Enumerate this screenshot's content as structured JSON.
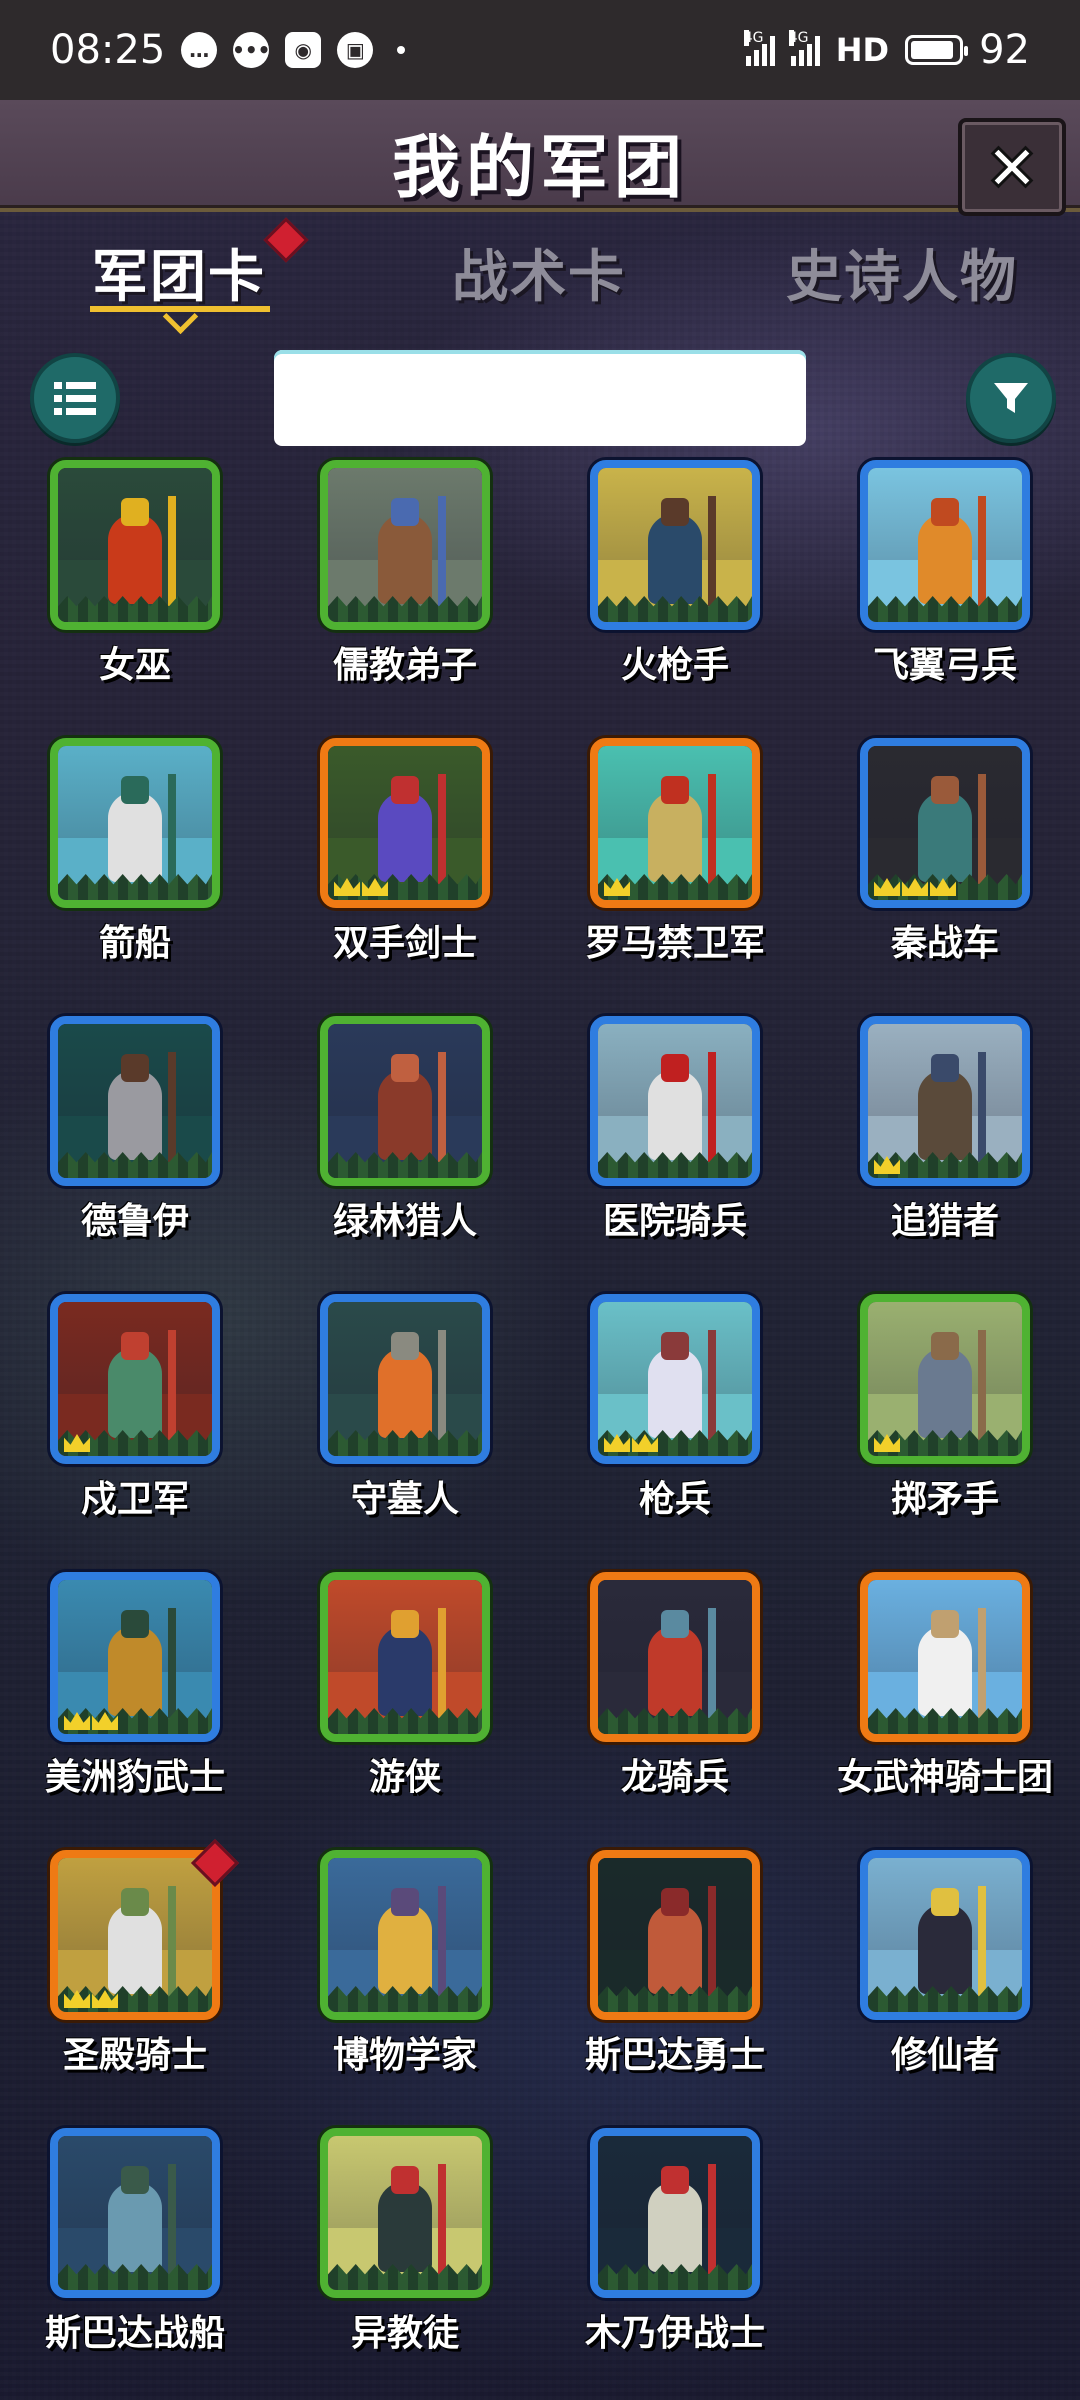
{
  "status_bar": {
    "time": "08:25",
    "notif_icons": [
      "chat-bubble-icon",
      "message-icon",
      "weibo-icon",
      "app-icon"
    ],
    "signal1_label": "4G",
    "signal2_label": "4G",
    "hd_label": "HD",
    "battery_percent": 92,
    "battery_text": "92"
  },
  "header": {
    "title": "我的军团",
    "close_icon": "close-icon"
  },
  "tabs": [
    {
      "label": "军团卡",
      "active": true,
      "has_badge": true
    },
    {
      "label": "战术卡",
      "active": false,
      "has_badge": false
    },
    {
      "label": "史诗人物",
      "active": false,
      "has_badge": false
    }
  ],
  "toolbar": {
    "list_icon": "list-icon",
    "filter_icon": "filter-icon",
    "search_value": "",
    "search_placeholder": ""
  },
  "colors": {
    "green": "#4fb232",
    "blue": "#2f7de0",
    "orange": "#ef7a14",
    "badge": "#d02030",
    "crown": "#f2d02a",
    "tab_underline": "#f0c030"
  },
  "cards": [
    {
      "name": "女巫",
      "rarity": "green",
      "crowns": 0,
      "badge": false,
      "art": [
        "#2a4a3a",
        "#c93a1a",
        "#e0b020"
      ]
    },
    {
      "name": "儒教弟子",
      "rarity": "green",
      "crowns": 0,
      "badge": false,
      "art": [
        "#6c7a6c",
        "#8a5a3a",
        "#4a6ab0"
      ]
    },
    {
      "name": "火枪手",
      "rarity": "blue",
      "crowns": 0,
      "badge": false,
      "art": [
        "#c9b34a",
        "#2a4a6a",
        "#5a3a2a"
      ]
    },
    {
      "name": "飞翼弓兵",
      "rarity": "blue",
      "crowns": 0,
      "badge": false,
      "art": [
        "#7ac4e0",
        "#e08a2a",
        "#c04a20"
      ]
    },
    {
      "name": "箭船",
      "rarity": "green",
      "crowns": 0,
      "badge": false,
      "art": [
        "#5ab0c8",
        "#e0e0e0",
        "#2a6a5a"
      ]
    },
    {
      "name": "双手剑士",
      "rarity": "orange",
      "crowns": 2,
      "badge": false,
      "art": [
        "#3a5a2a",
        "#5a4ac0",
        "#c03030"
      ]
    },
    {
      "name": "罗马禁卫军",
      "rarity": "orange",
      "crowns": 1,
      "badge": false,
      "art": [
        "#4ac0b0",
        "#c8b060",
        "#c03020"
      ]
    },
    {
      "name": "秦战车",
      "rarity": "blue",
      "crowns": 3,
      "badge": false,
      "art": [
        "#2a2a30",
        "#3a7a7a",
        "#9a5a3a"
      ]
    },
    {
      "name": "德鲁伊",
      "rarity": "blue",
      "crowns": 0,
      "badge": false,
      "art": [
        "#1a4a4a",
        "#9a9aa0",
        "#5a3a2a"
      ]
    },
    {
      "name": "绿林猎人",
      "rarity": "green",
      "crowns": 0,
      "badge": false,
      "art": [
        "#2a3a5a",
        "#8a3a2a",
        "#c06040"
      ]
    },
    {
      "name": "医院骑兵",
      "rarity": "blue",
      "crowns": 0,
      "badge": false,
      "art": [
        "#8ab0c0",
        "#e0e0e0",
        "#c02020"
      ]
    },
    {
      "name": "追猎者",
      "rarity": "blue",
      "crowns": 1,
      "badge": false,
      "art": [
        "#9ab0c0",
        "#5a4a3a",
        "#3a4a6a"
      ]
    },
    {
      "name": "戍卫军",
      "rarity": "blue",
      "crowns": 1,
      "badge": false,
      "art": [
        "#7a2a20",
        "#4a8a6a",
        "#c04030"
      ]
    },
    {
      "name": "守墓人",
      "rarity": "blue",
      "crowns": 0,
      "badge": false,
      "art": [
        "#2a4a4a",
        "#e0702a",
        "#8a8a80"
      ]
    },
    {
      "name": "枪兵",
      "rarity": "blue",
      "crowns": 2,
      "badge": false,
      "art": [
        "#6ac0c8",
        "#e0e0f0",
        "#8a3a3a"
      ]
    },
    {
      "name": "掷矛手",
      "rarity": "green",
      "crowns": 1,
      "badge": false,
      "art": [
        "#9ab070",
        "#6a7a90",
        "#8a6a4a"
      ]
    },
    {
      "name": "美洲豹武士",
      "rarity": "blue",
      "crowns": 2,
      "badge": false,
      "art": [
        "#3a8ab0",
        "#c08a2a",
        "#2a4a3a"
      ]
    },
    {
      "name": "游侠",
      "rarity": "green",
      "crowns": 0,
      "badge": false,
      "art": [
        "#c04a2a",
        "#2a3a6a",
        "#e0a030"
      ]
    },
    {
      "name": "龙骑兵",
      "rarity": "orange",
      "crowns": 0,
      "badge": false,
      "art": [
        "#2a2a3a",
        "#c03a2a",
        "#5a8aa0"
      ]
    },
    {
      "name": "女武神骑士团",
      "rarity": "orange",
      "crowns": 0,
      "badge": false,
      "art": [
        "#6ab0e0",
        "#f0f0f0",
        "#c0a070"
      ]
    },
    {
      "name": "圣殿骑士",
      "rarity": "orange",
      "crowns": 2,
      "badge": true,
      "art": [
        "#c0a040",
        "#e0e0e0",
        "#6a8a4a"
      ]
    },
    {
      "name": "博物学家",
      "rarity": "green",
      "crowns": 0,
      "badge": false,
      "art": [
        "#3a6a9a",
        "#e0b040",
        "#5a4a7a"
      ]
    },
    {
      "name": "斯巴达勇士",
      "rarity": "orange",
      "crowns": 0,
      "badge": false,
      "art": [
        "#1a2a2a",
        "#c05a3a",
        "#8a2a2a"
      ]
    },
    {
      "name": "修仙者",
      "rarity": "blue",
      "crowns": 0,
      "badge": false,
      "art": [
        "#7ab0d0",
        "#2a2a3a",
        "#e0c040"
      ]
    },
    {
      "name": "斯巴达战船",
      "rarity": "blue",
      "crowns": 0,
      "badge": false,
      "art": [
        "#2a4a6a",
        "#6a9ab0",
        "#3a5a4a"
      ]
    },
    {
      "name": "异教徒",
      "rarity": "green",
      "crowns": 0,
      "badge": false,
      "art": [
        "#c8c870",
        "#2a3a3a",
        "#c03030"
      ]
    },
    {
      "name": "木乃伊战士",
      "rarity": "blue",
      "crowns": 0,
      "badge": false,
      "art": [
        "#1a2a3a",
        "#d0d0c0",
        "#c03030"
      ]
    }
  ]
}
